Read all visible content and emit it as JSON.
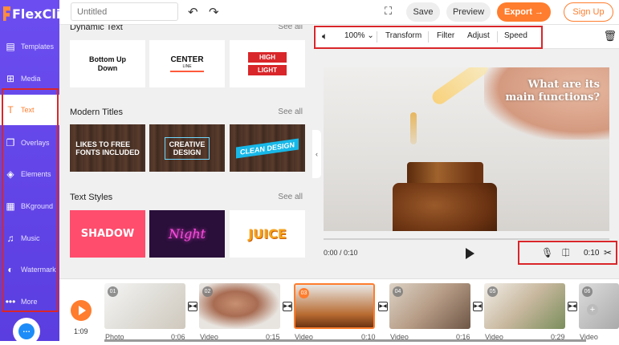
{
  "app": {
    "logo_text": "FlexClip"
  },
  "sidebar": {
    "items": [
      {
        "label": "Templates",
        "icon": "templates-icon"
      },
      {
        "label": "Media",
        "icon": "media-icon"
      },
      {
        "label": "Text",
        "icon": "text-icon"
      },
      {
        "label": "Overlays",
        "icon": "overlays-icon"
      },
      {
        "label": "Elements",
        "icon": "elements-icon"
      },
      {
        "label": "BKground",
        "icon": "background-icon"
      },
      {
        "label": "Music",
        "icon": "music-icon"
      },
      {
        "label": "Watermark",
        "icon": "watermark-icon"
      },
      {
        "label": "More",
        "icon": "more-icon"
      }
    ],
    "active": "Text"
  },
  "topbar": {
    "title_placeholder": "Untitled",
    "save_label": "Save",
    "preview_label": "Preview",
    "export_label": "Export →",
    "signup_label": "Sign Up"
  },
  "panel": {
    "sections": [
      {
        "heading": "Dynamic Text",
        "see_all": "See all",
        "tiles": [
          {
            "line1": "Bottom Up",
            "line2": "Down"
          },
          {
            "main": "CENTER",
            "sub": "LINE"
          },
          {
            "line1": "HIGH",
            "line2": "LIGHT"
          }
        ]
      },
      {
        "heading": "Modern Titles",
        "see_all": "See all",
        "tiles": [
          {
            "line1": "LIKES TO FREE",
            "line2": "FONTS INCLUDED"
          },
          {
            "line1": "CREATIVE",
            "line2": "DESIGN"
          },
          {
            "line1": "CLEAN DESIGN"
          }
        ]
      },
      {
        "heading": "Text Styles",
        "see_all": "See all",
        "tiles": [
          {
            "text": "SHADOW"
          },
          {
            "text": "Night"
          },
          {
            "text": "JUICE"
          }
        ]
      }
    ]
  },
  "editor": {
    "toolbar": {
      "volume_icon": "volume-icon",
      "zoom": "100%",
      "transform": "Transform",
      "filter": "Filter",
      "adjust": "Adjust",
      "speed": "Speed"
    },
    "canvas_caption": {
      "line1": "What are its",
      "line2": "main functions?"
    },
    "playback": {
      "time": "0:00 / 0:10",
      "duration": "0:10"
    }
  },
  "timeline": {
    "total_time": "1:09",
    "clips": [
      {
        "num": "01",
        "type": "Photo",
        "duration": "0:06"
      },
      {
        "num": "02",
        "type": "Video",
        "duration": "0:15"
      },
      {
        "num": "03",
        "type": "Video",
        "duration": "0:10"
      },
      {
        "num": "04",
        "type": "Video",
        "duration": "0:16"
      },
      {
        "num": "05",
        "type": "Video",
        "duration": "0:29"
      },
      {
        "num": "06",
        "type": "Video",
        "duration": ""
      }
    ],
    "selected_clip": "03",
    "add_label": "+"
  },
  "colors": {
    "sidebar_bg": "#5b3ee0",
    "accent": "#ff7d2e",
    "highlight_box": "#d9262a"
  }
}
